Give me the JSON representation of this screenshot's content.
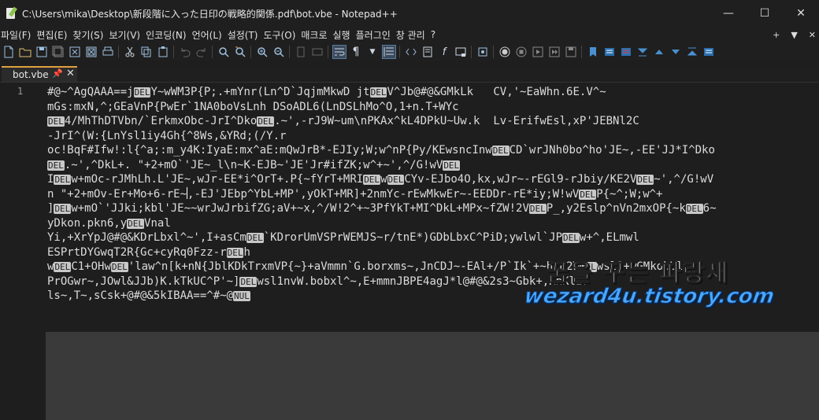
{
  "window": {
    "title": "C:\\Users\\mika\\Desktop\\新段階に入った日印の戦略的関係.pdf\\bot.vbe - Notepad++",
    "minimize": "—",
    "maximize": "☐",
    "close": "✕"
  },
  "menu": {
    "items": [
      "파일(F)",
      "편집(E)",
      "찾기(S)",
      "보기(V)",
      "인코딩(N)",
      "언어(L)",
      "설정(T)",
      "도구(O)",
      "매크로",
      "실행",
      "플러그인",
      "창 관리",
      "?"
    ],
    "right": [
      "+",
      "▼",
      "✕"
    ]
  },
  "toolbar": {
    "icons": [
      "new-file-icon",
      "open-file-icon",
      "save-icon",
      "save-all-icon",
      "close-icon",
      "close-all-icon",
      "print-icon",
      "cut-icon",
      "copy-icon",
      "paste-icon",
      "undo-icon",
      "redo-icon",
      "find-icon",
      "replace-icon",
      "zoom-in-icon",
      "zoom-out-icon",
      "sync-v-icon",
      "sync-h-icon",
      "word-wrap-icon",
      "show-all-chars-icon",
      "indent-guide-icon",
      "udl-icon",
      "doc-map-icon",
      "function-list-icon",
      "folder-workspace-icon",
      "monitor-icon",
      "record-macro-icon",
      "stop-macro-icon",
      "play-macro-icon",
      "run-macro-icon",
      "save-macro-icon"
    ]
  },
  "tab": {
    "label": "bot.vbe",
    "pin": "📌",
    "close": "✕"
  },
  "editor": {
    "line_number": "1",
    "lines": [
      [
        {
          "t": "#@~^AgQAAA==j"
        },
        {
          "c": "DEL"
        },
        {
          "t": "Y~wWM3P{P;.+mYnr(Ln^D`JqjmMkwD jt"
        },
        {
          "c": "DEL"
        },
        {
          "t": "V^Jb@#@&GMkLk   CV,'~EaWhn.6E.V^~"
        }
      ],
      [
        {
          "t": "mGs:mxN,^;GEaVnP{PwEr`1NA0boVsLnh DSoADL6(LnDSLhMo^O,1+n.T+WYc"
        }
      ],
      [
        {
          "c": "DEL"
        },
        {
          "t": "4/MhThDTVbn/`ErkmxObc-JrI^Dko"
        },
        {
          "c": "DEL"
        },
        {
          "t": ".~',-rJ9W~um\\nPKAx^kL4DPkU~Uw.k  Lv-ErifwEsl,xP'JEBNl2C"
        }
      ],
      [
        {
          "t": "-JrI^(W:{LnYsl1iy4Gh{^8Ws,&YRd;(/Y.r"
        }
      ],
      [
        {
          "t": "oc!BqF#Ifw!:l{^a;:m_y4K:IyaE:mx^aE:mQwJrB*-EJIy;W;w^nP{Py/KEwsncInw"
        },
        {
          "c": "DEL"
        },
        {
          "t": "CD`wrJNh0bo^ho'JE~,-EE'JJ*I^Dko"
        }
      ],
      [
        {
          "c": "DEL"
        },
        {
          "t": ".~',^DkL+. \"+2+mO`'JE~_l\\n~K-EJB~'JE'Jr#ifZK;w^+~',^/G!wV"
        },
        {
          "c": "DEL"
        }
      ],
      [
        {
          "t": "I"
        },
        {
          "c": "DEL"
        },
        {
          "t": "w+mOc-rJMhLh.L'JE~,wJr-EE*i^OrT+.P{~fYrT+MRI"
        },
        {
          "c": "DEL"
        },
        {
          "t": "w"
        },
        {
          "c": "DEL"
        },
        {
          "t": "CYv-EJbo4O,kx,wJr~-rEGl9-rJbiy/KE2V"
        },
        {
          "c": "DEL"
        },
        {
          "t": "~',^/G!wV"
        }
      ],
      [
        {
          "t": "n \"+2+mOv-Er+Mo+6-rE~"
        },
        {
          "caret": true
        },
        {
          "t": ",-EJ'JEbp^YbL+MP',yOkT+MR]+2nmYc-rEwMkwEr~-EEDDr-rE*iy;W!wV"
        },
        {
          "c": "DEL"
        },
        {
          "t": "P{~^;W;w^+"
        }
      ],
      [
        {
          "t": "]"
        },
        {
          "c": "DEL"
        },
        {
          "t": "w+mO`'JJki;kbl'JE~~wrJwJrbifZG;aV+~x,^/W!2^+~3PfYkT+MI^DkL+MPx~fZW!2V"
        },
        {
          "c": "DEL"
        },
        {
          "t": "P_,y2Eslp^nVn2mxOP{~k"
        },
        {
          "c": "DEL"
        },
        {
          "t": "6~"
        }
      ],
      [
        {
          "t": "yDkon.pkn6,y"
        },
        {
          "c": "DEL"
        },
        {
          "t": "Vnal"
        }
      ],
      [
        {
          "t": "Yi,+XrYpJ@#@&KDrLbxl^~',I+asCm"
        },
        {
          "c": "DEL"
        },
        {
          "t": "`KDrorUmVSPrWEMJS~r/tnE*)GDbLbxC^PiD;ywlwl`JP"
        },
        {
          "c": "DEL"
        },
        {
          "t": "w+^,ELmwl"
        }
      ],
      [
        {
          "t": "ESPrtDYGwqT2R{Gc+cyRq0Fzz-r"
        },
        {
          "c": "DEL"
        },
        {
          "t": "h"
        }
      ],
      [
        {
          "t": "w"
        },
        {
          "c": "DEL"
        },
        {
          "t": "C1+OHw"
        },
        {
          "c": "DEL"
        },
        {
          "t": "'law^n[k+nN{JblKDkTrxmVP{~}+aVmmn`G.borxms~,JnCDJ~-EAl+/P`Ik`+~hkN2W"
        },
        {
          "c": "DEL"
        },
        {
          "t": "wsl1+wGMkobUl^~"
        }
      ],
      [
        {
          "t": "PrOGwr~,JOwl&JJb)K.kTkUC^P'~]"
        },
        {
          "c": "DEL"
        },
        {
          "t": "wsl1nvW.bobxl^~,E+mmnJBPE4agJ*l@#@&2s3~Gbk+,KnKlzr"
        }
      ],
      [
        {
          "t": "ls~,T~,sCsk+@#@&5kIBAA==^#~@"
        },
        {
          "c": "NUL"
        }
      ]
    ]
  },
  "watermark": {
    "korean": "꿈을 꾸는 파랑새",
    "url": "wezard4u.tistory.com"
  }
}
